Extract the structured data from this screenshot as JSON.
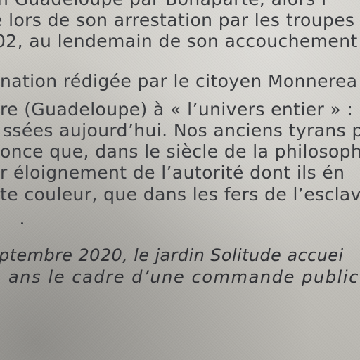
{
  "lines": [
    "n Guadeloupe par Bonaparte, alors P",
    "e lors de son arrestation par les troupes",
    "02, au lendemain de son accouchement",
    "nation rédigée par le citoyen Monnerea",
    "re (Guadeloupe) à « l’univers entier » : «",
    "ssées aujourd’hui. Nos anciens tyrans p",
    "once que, dans le siècle de la philosoph",
    "r éloignement de l’autorité dont ils én",
    "te couleur, que dans les fers de l’esclava",
    "ptembre 2020, le jardin Solitude accuei",
    "ans le cadre d’une commande public"
  ]
}
